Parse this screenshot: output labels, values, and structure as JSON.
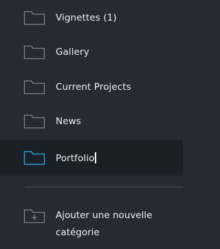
{
  "folders": [
    {
      "label": "Vignettes (1)",
      "active": false
    },
    {
      "label": "Gallery",
      "active": false
    },
    {
      "label": "Current Projects",
      "active": false
    },
    {
      "label": "News",
      "active": false
    },
    {
      "label": "Portfolio",
      "active": true
    }
  ],
  "add_category": {
    "label": "Ajouter une nouvelle catégorie",
    "icon": "folder-plus-icon"
  },
  "colors": {
    "background": "#252b33",
    "active_row": "#1b2027",
    "folder_icon": "#7c848d",
    "folder_icon_active": "#2f9ad8",
    "text": "#eef1f4",
    "divider": "#454c56"
  }
}
